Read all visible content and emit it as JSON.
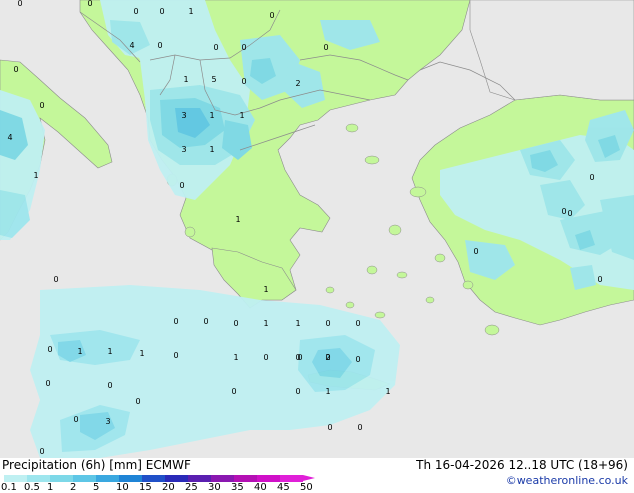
{
  "title": "Precipitation (6h) [mm] ECMWF",
  "run_info": "Th 16-04-2026 12..18 UTC (18+96)",
  "credit": "©weatheronline.co.uk",
  "colors": {
    "sea": "#e8e8e8",
    "land_dry": "#c4f79a",
    "border": "#8c8c8c",
    "precip_01": "#bff0f2",
    "precip_05": "#9ee6ee",
    "precip_1": "#7dd8e8",
    "precip_2": "#5ec6e6",
    "precip_5": "#3aa8e0"
  },
  "legend": {
    "ticks": [
      "0.1",
      "0.5",
      "1",
      "2",
      "5",
      "10",
      "15",
      "20",
      "25",
      "30",
      "35",
      "40",
      "45",
      "50"
    ],
    "colors": [
      "#bff0f2",
      "#9ee6ee",
      "#7dd8e8",
      "#5ec6e6",
      "#3aa8e0",
      "#1f84d6",
      "#2050c8",
      "#2a2ab8",
      "#5a1fb0",
      "#8a18b0",
      "#b410b4",
      "#d010c8",
      "#e020d8"
    ]
  },
  "point_labels": [
    "0",
    "0",
    "1",
    "0",
    "4",
    "0",
    "0",
    "0",
    "0",
    "0",
    "1",
    "5",
    "0",
    "2",
    "3",
    "1",
    "1",
    "3",
    "1",
    "4",
    "1",
    "1",
    "0",
    "0",
    "1",
    "0",
    "0",
    "0",
    "1",
    "1",
    "0",
    "0",
    "1",
    "0",
    "1",
    "1",
    "0",
    "1",
    "0",
    "0",
    "0",
    "2",
    "0",
    "0",
    "0",
    "1",
    "0",
    "0",
    "3",
    "0",
    "0",
    "1",
    "0",
    "0",
    "0",
    "0",
    "0",
    "0",
    "0",
    "0",
    "0",
    "0",
    "0",
    "0"
  ]
}
